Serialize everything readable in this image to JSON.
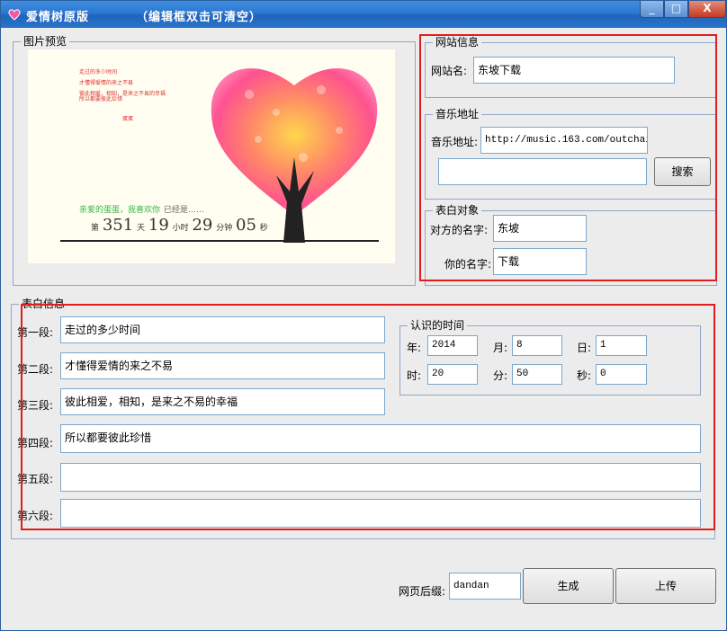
{
  "titlebar": {
    "title": "爱情树原版",
    "hint": "（编辑框双击可清空）",
    "min_glyph": "_",
    "max_glyph": "□",
    "close_glyph": "X"
  },
  "preview": {
    "legend": "图片预览",
    "lines": [
      "走过的多少时间",
      "才懂得爱情的来之不易",
      "彼此相爱，相知，是来之不易的幸福",
      "所以都要彼此珍惜",
      "蛋蛋"
    ],
    "dear": "亲爱的蛋蛋，我喜欢你",
    "already": "已经是……",
    "counter": {
      "p1": "第",
      "days": "351",
      "u_days": "天",
      "hours": "19",
      "u_hours": "小时",
      "minutes": "29",
      "u_minutes": "分钟",
      "seconds": "05",
      "u_seconds": "秒"
    }
  },
  "site": {
    "legend": "网站信息",
    "label": "网站名:",
    "value": "东坡下载"
  },
  "music": {
    "legend": "音乐地址",
    "label": "音乐地址:",
    "value": "http://music.163.com/outchain/p",
    "search_value": "",
    "search_button": "搜索"
  },
  "target": {
    "legend": "表白对象",
    "their_label": "对方的名字:",
    "their_value": "东坡",
    "your_label": "你的名字:",
    "your_value": "下载"
  },
  "confession": {
    "legend": "表白信息",
    "paragraphs": [
      {
        "label": "第一段:",
        "value": "走过的多少时间"
      },
      {
        "label": "第二段:",
        "value": "才懂得爱情的来之不易"
      },
      {
        "label": "第三段:",
        "value": "彼此相爱，相知，是来之不易的幸福"
      },
      {
        "label": "第四段:",
        "value": "所以都要彼此珍惜"
      },
      {
        "label": "第五段:",
        "value": ""
      },
      {
        "label": "第六段:",
        "value": ""
      }
    ]
  },
  "known_time": {
    "legend": "认识的时间",
    "year_label": "年:",
    "year": "2014",
    "month_label": "月:",
    "month": "8",
    "day_label": "日:",
    "day": "1",
    "hour_label": "时:",
    "hour": "20",
    "minute_label": "分:",
    "minute": "50",
    "second_label": "秒:",
    "second": "0"
  },
  "footer": {
    "suffix_label": "网页后缀:",
    "suffix_value": "dandan",
    "generate_button": "生成",
    "upload_button": "上传"
  },
  "colors": {
    "titlebar": "#2d77cf",
    "highlight_box": "#e11d1d",
    "field_border": "#7ea7cc"
  }
}
